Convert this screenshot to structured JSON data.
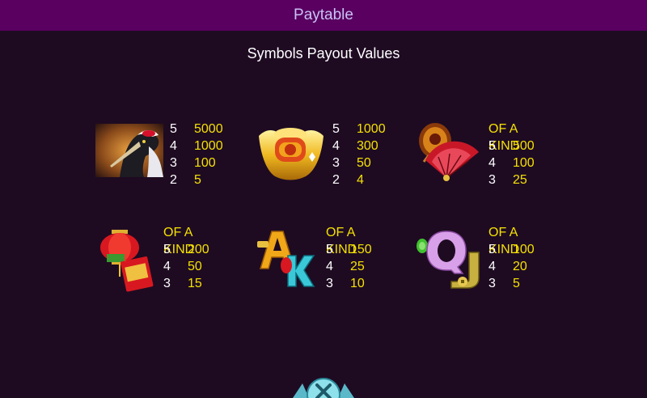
{
  "header": {
    "title": "Paytable"
  },
  "subtitle": "Symbols Payout Values",
  "symbols": [
    {
      "icon": "crane-icon",
      "of_a_kind": "",
      "rows": [
        {
          "count": "5",
          "value": "5000"
        },
        {
          "count": "4",
          "value": "1000"
        },
        {
          "count": "3",
          "value": "100"
        },
        {
          "count": "2",
          "value": "5"
        }
      ]
    },
    {
      "icon": "gold-ingot-icon",
      "of_a_kind": "",
      "rows": [
        {
          "count": "5",
          "value": "1000"
        },
        {
          "count": "4",
          "value": "300"
        },
        {
          "count": "3",
          "value": "50"
        },
        {
          "count": "2",
          "value": "4"
        }
      ]
    },
    {
      "icon": "drum-fan-icon",
      "of_a_kind": "OF A KIND",
      "rows": [
        {
          "count": "5",
          "value": "500"
        },
        {
          "count": "4",
          "value": "100"
        },
        {
          "count": "3",
          "value": "25"
        }
      ]
    },
    {
      "icon": "lantern-envelope-icon",
      "of_a_kind": "OF A KIND",
      "rows": [
        {
          "count": "5",
          "value": "200"
        },
        {
          "count": "4",
          "value": "50"
        },
        {
          "count": "3",
          "value": "15"
        }
      ]
    },
    {
      "icon": "letters-a-k-icon",
      "of_a_kind": "OF A KIND",
      "rows": [
        {
          "count": "5",
          "value": "150"
        },
        {
          "count": "4",
          "value": "25"
        },
        {
          "count": "3",
          "value": "10"
        }
      ]
    },
    {
      "icon": "letters-q-j-icon",
      "of_a_kind": "OF A KIND",
      "rows": [
        {
          "count": "5",
          "value": "100"
        },
        {
          "count": "4",
          "value": "20"
        },
        {
          "count": "3",
          "value": "5"
        }
      ]
    }
  ],
  "colors": {
    "header_bg": "#590060",
    "background": "#1e0b22",
    "payout": "#f5e100",
    "title": "#c9c2f5"
  }
}
